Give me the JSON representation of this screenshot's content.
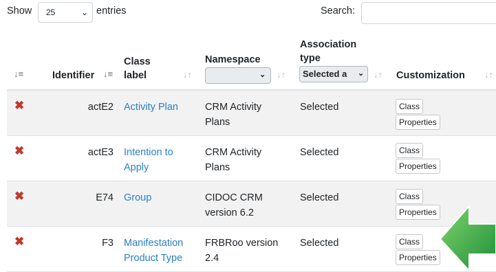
{
  "controls": {
    "show_label": "Show",
    "entries_value": "25",
    "entries_label": "entries",
    "search_label": "Search:",
    "search_value": ""
  },
  "table": {
    "headers": {
      "identifier": "Identifier",
      "class_label_1": "Class",
      "class_label_2": "label",
      "namespace": "Namespace",
      "association_1": "Association",
      "association_2": "type",
      "customization": "Customization"
    },
    "filters": {
      "namespace_value": "",
      "association_value": "Selected a"
    },
    "rows": [
      {
        "identifier": "actE2",
        "label_1": "Activity Plan",
        "label_2": "",
        "ns_1": "CRM Activity",
        "ns_2": "Plans",
        "assoc": "Selected",
        "btn_class": "Class",
        "btn_props": "Properties"
      },
      {
        "identifier": "actE3",
        "label_1": "Intention to",
        "label_2": "Apply",
        "ns_1": "CRM Activity",
        "ns_2": "Plans",
        "assoc": "Selected",
        "btn_class": "Class",
        "btn_props": "Properties"
      },
      {
        "identifier": "E74",
        "label_1": "Group",
        "label_2": "",
        "ns_1": "CIDOC CRM",
        "ns_2": "version 6.2",
        "assoc": "Selected",
        "btn_class": "Class",
        "btn_props": "Properties"
      },
      {
        "identifier": "F3",
        "label_1": "Manifestation",
        "label_2": "Product Type",
        "ns_1": "FRBRoo version",
        "ns_2": "2.4",
        "assoc": "Selected",
        "btn_class": "Class",
        "btn_props": "Properties"
      }
    ]
  },
  "colors": {
    "link": "#2a7fc4",
    "delete": "#c0392b",
    "arrow": "#3cb04b"
  }
}
